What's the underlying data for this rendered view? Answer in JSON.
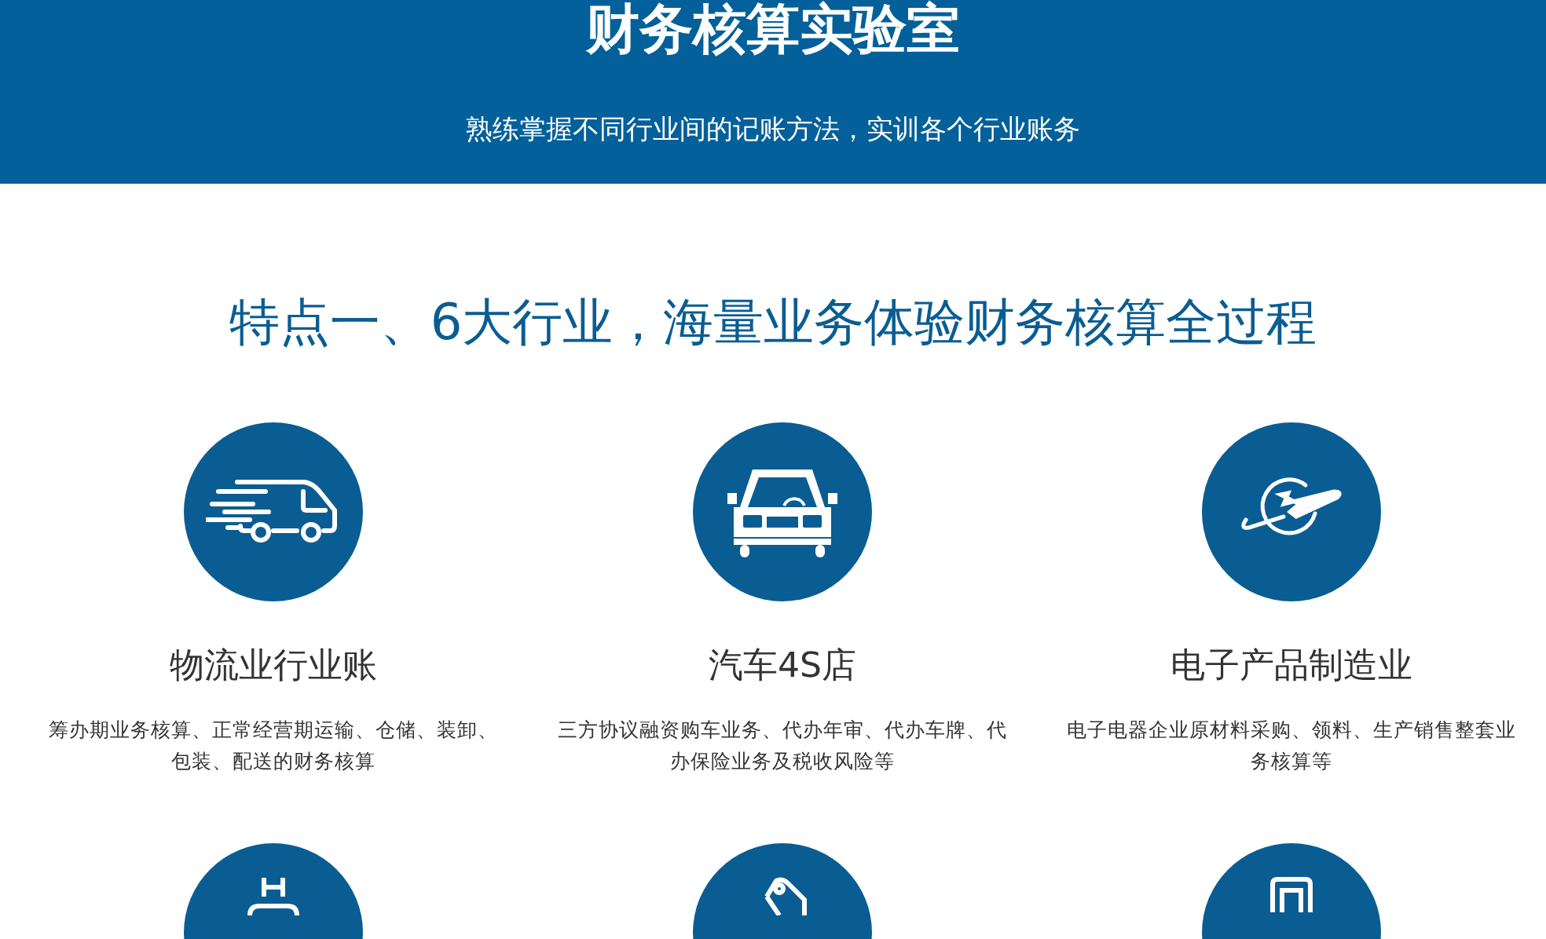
{
  "header": {
    "title": "财务核算实验室",
    "subtitle": "熟练掌握不同行业间的记账方法，实训各个行业账务"
  },
  "section": {
    "heading": "特点一、6大行业，海量业务体验财务核算全过程"
  },
  "features": [
    {
      "kind": "truck",
      "title": "物流业行业账",
      "description": "筹办期业务核算、正常经营期运输、仓储、装卸、包装、配送的财务核算"
    },
    {
      "kind": "car",
      "title": "汽车4S店",
      "description": "三方协议融资购车业务、代办年审、代办车牌、代办保险业务及税收风险等"
    },
    {
      "kind": "plane",
      "title": "电子产品制造业",
      "description": "电子电器企业原材料采购、领料、生产销售整套业务核算等"
    },
    {
      "kind": "hospital"
    },
    {
      "kind": "tag"
    },
    {
      "kind": "printer"
    }
  ]
}
